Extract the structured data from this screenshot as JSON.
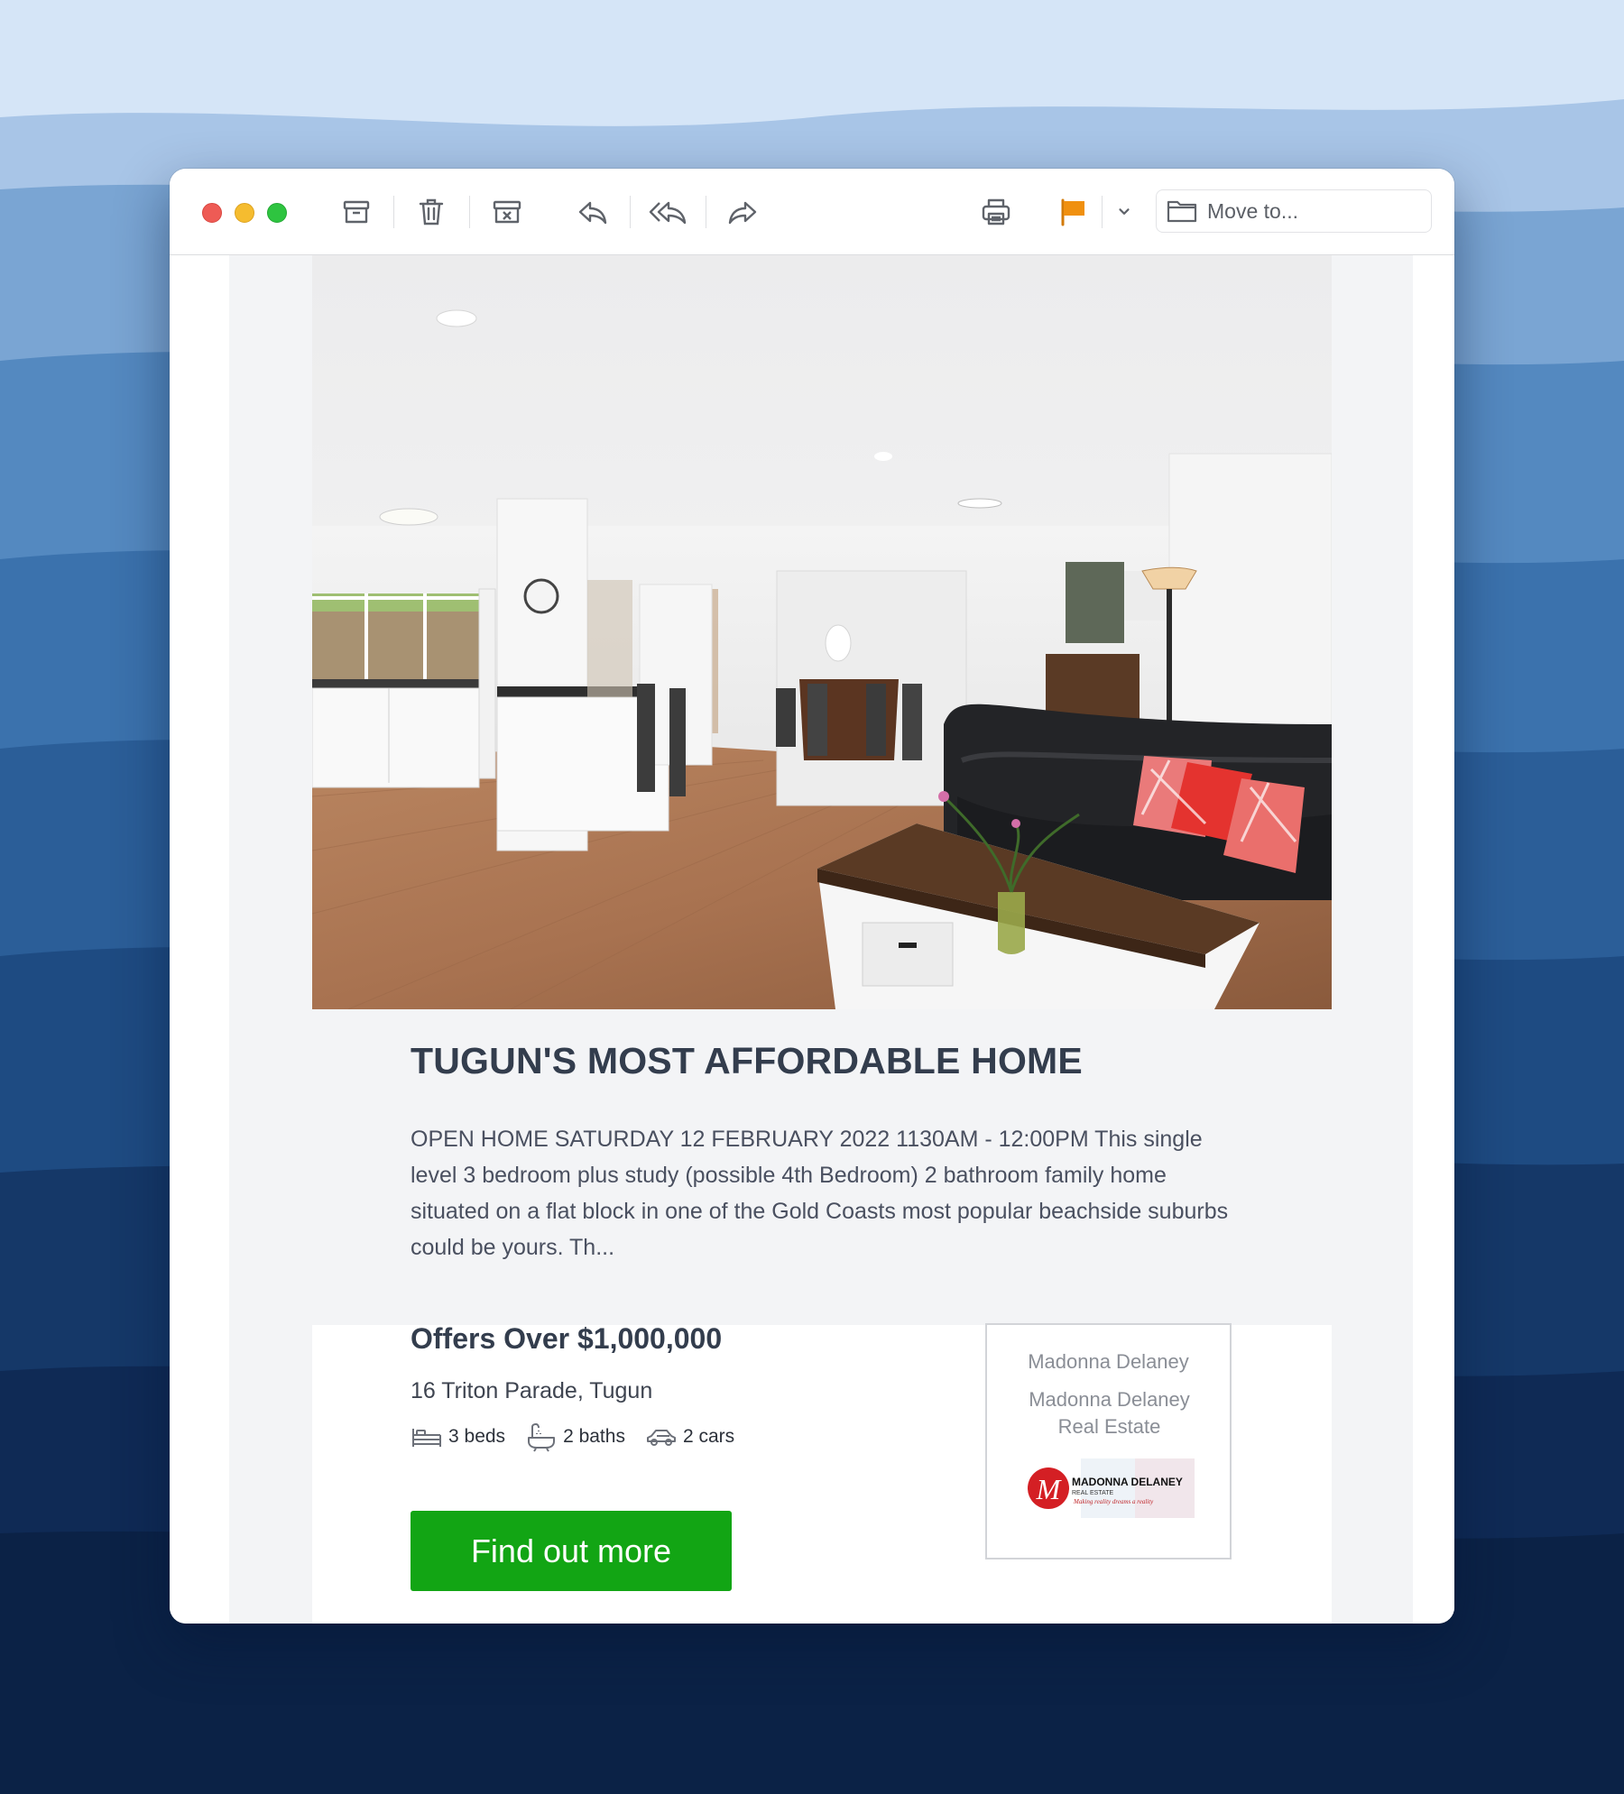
{
  "window": {
    "toolbar": {
      "archive_label": "Archive",
      "delete_label": "Delete",
      "junk_label": "Junk",
      "reply_label": "Reply",
      "reply_all_label": "Reply All",
      "forward_label": "Forward",
      "print_label": "Print",
      "flag_label": "Flag",
      "move_placeholder": "Move to..."
    }
  },
  "colors": {
    "flag": "#f0900f",
    "cta": "#12a514",
    "traffic_close": "#ee5b55",
    "traffic_minimize": "#f5bc2f",
    "traffic_zoom": "#2ec440"
  },
  "listing": {
    "title": "TUGUN'S MOST AFFORDABLE HOME",
    "description": "OPEN HOME SATURDAY 12 FEBRUARY 2022 1130AM - 12:00PM This single level 3 bedroom plus study (possible 4th Bedroom) 2 bathroom family home situated on a flat block in one of the Gold Coasts most popular beachside suburbs could be yours. Th...",
    "price": "Offers Over $1,000,000",
    "address": "16 Triton Parade, Tugun",
    "features": {
      "beds": "3 beds",
      "baths": "2 baths",
      "cars": "2 cars"
    },
    "cta_label": "Find out more"
  },
  "agent": {
    "name": "Madonna Delaney",
    "agency": "Madonna Delaney Real Estate",
    "logo": {
      "monogram": "M",
      "brand": "MADONNA DELANEY",
      "sub": "REAL ESTATE",
      "tagline": "Making reality dreams a reality"
    }
  }
}
